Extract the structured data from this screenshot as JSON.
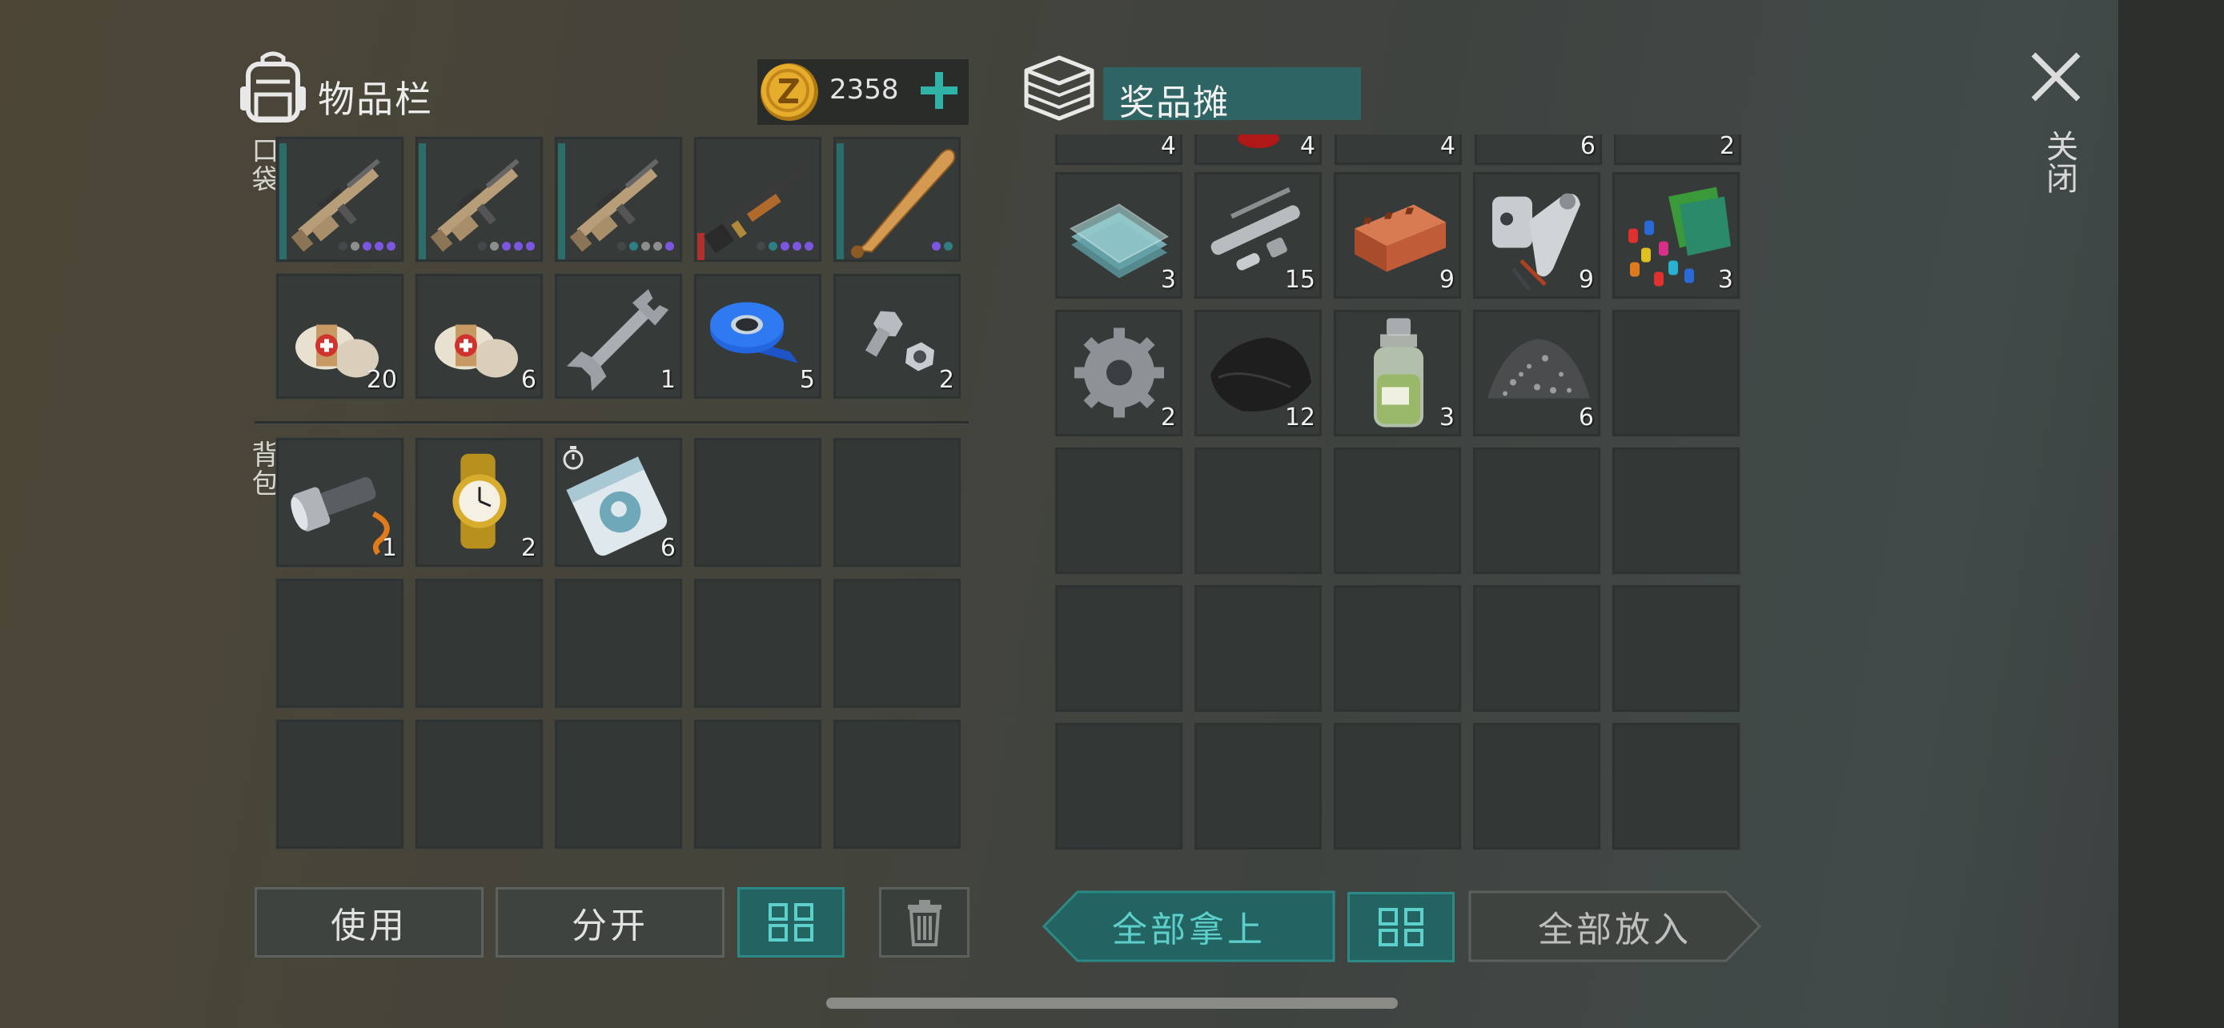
{
  "inventory": {
    "title": "物品栏",
    "pocket_label": "口袋",
    "bag_label": "背包",
    "currency_value": "2358",
    "pocket_slots": [
      {
        "icon": "assault-rifle-icon",
        "qty": "",
        "durability": "full",
        "mods": [
          "dark",
          "grey",
          "purple",
          "purple",
          "purple"
        ]
      },
      {
        "icon": "assault-rifle-icon",
        "qty": "",
        "durability": "full",
        "mods": [
          "dark",
          "grey",
          "purple",
          "purple",
          "purple"
        ]
      },
      {
        "icon": "assault-rifle-icon",
        "qty": "",
        "durability": "full",
        "mods": [
          "dark",
          "teal",
          "grey",
          "grey",
          "purple"
        ]
      },
      {
        "icon": "shotgun-icon",
        "qty": "",
        "durability": "low",
        "mods": [
          "dark",
          "teal",
          "purple",
          "purple",
          "purple"
        ]
      },
      {
        "icon": "baseball-bat-icon",
        "qty": "",
        "durability": "full",
        "mods": [
          "purple",
          "teal"
        ]
      },
      {
        "icon": "bandage-icon",
        "qty": "20"
      },
      {
        "icon": "bandage-icon",
        "qty": "6"
      },
      {
        "icon": "wrench-icon",
        "qty": "1"
      },
      {
        "icon": "tape-icon",
        "qty": "5"
      },
      {
        "icon": "bolts-icon",
        "qty": "2"
      }
    ],
    "bag_slots": [
      {
        "icon": "flashlight-icon",
        "qty": "1"
      },
      {
        "icon": "wristwatch-icon",
        "qty": "2"
      },
      {
        "icon": "seed-packet-icon",
        "qty": "6",
        "timer": true
      }
    ]
  },
  "stall": {
    "title": "奖品摊",
    "partial_row": [
      "4",
      "4",
      "4",
      "6",
      "2"
    ],
    "slots": [
      {
        "icon": "glass-icon",
        "qty": "3"
      },
      {
        "icon": "pipes-icon",
        "qty": "15"
      },
      {
        "icon": "brick-icon",
        "qty": "9"
      },
      {
        "icon": "mechanical-parts-icon",
        "qty": "9"
      },
      {
        "icon": "cables-icon",
        "qty": "3"
      },
      {
        "icon": "gear-icon",
        "qty": "2"
      },
      {
        "icon": "leather-icon",
        "qty": "12"
      },
      {
        "icon": "chemical-flask-icon",
        "qty": "3"
      },
      {
        "icon": "gravel-icon",
        "qty": "6"
      }
    ]
  },
  "close_label": "关闭",
  "buttons": {
    "use": "使用",
    "split": "分开",
    "take_all": "全部拿上",
    "put_all": "全部放入"
  },
  "colors": {
    "accent": "#236362",
    "accent_text": "#5dd0cc",
    "coin": "#e0a92a",
    "rarity_purple": "#7c56e0"
  }
}
